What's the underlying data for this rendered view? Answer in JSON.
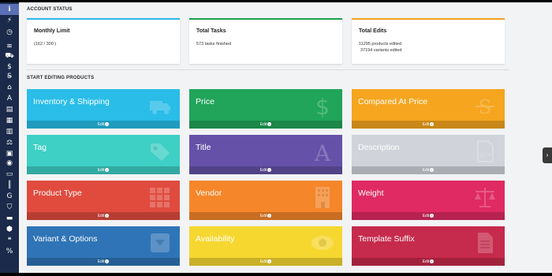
{
  "sidebar": {
    "icons": [
      {
        "name": "info-icon",
        "glyph": "ℹ",
        "active": true
      },
      {
        "name": "bolt-icon",
        "glyph": "⚡"
      },
      {
        "name": "clock-icon",
        "glyph": "◷"
      },
      {
        "name": "layers-icon",
        "glyph": "≋"
      },
      {
        "name": "truck-icon",
        "glyph": "⛟"
      },
      {
        "name": "dollar-icon",
        "glyph": "$"
      },
      {
        "name": "strikethrough-icon",
        "glyph": "S̶"
      },
      {
        "name": "tag-icon",
        "glyph": "⌂"
      },
      {
        "name": "font-icon",
        "glyph": "A"
      },
      {
        "name": "file-icon",
        "glyph": "▤"
      },
      {
        "name": "grid-icon",
        "glyph": "▦"
      },
      {
        "name": "barcode-icon",
        "glyph": "▥"
      },
      {
        "name": "balance-icon",
        "glyph": "⚖"
      },
      {
        "name": "box-icon",
        "glyph": "▣"
      },
      {
        "name": "eye-icon",
        "glyph": "◉"
      },
      {
        "name": "document-icon",
        "glyph": "▭"
      },
      {
        "name": "barcode2-icon",
        "glyph": "║"
      },
      {
        "name": "google-icon",
        "glyph": "G"
      },
      {
        "name": "cart-icon",
        "glyph": "⛉"
      },
      {
        "name": "shipping-icon",
        "glyph": "▬"
      },
      {
        "name": "cubes-icon",
        "glyph": "⬢"
      },
      {
        "name": "quote-icon",
        "glyph": "❝"
      },
      {
        "name": "percent-icon",
        "glyph": "%"
      }
    ]
  },
  "account_status": {
    "title": "ACCOUNT STATUS",
    "cards": [
      {
        "title": "Monthly Limit",
        "lines": [
          "(162 / 300 )"
        ],
        "accent": "#29b6e8"
      },
      {
        "title": "Total Tasks",
        "lines": [
          "573 tasks finished"
        ],
        "accent": "#1e9e50"
      },
      {
        "title": "Total Edits",
        "lines": [
          "11295 products edited",
          "37194 variants edited"
        ],
        "accent": "#f0a11e"
      }
    ]
  },
  "editing": {
    "title": "START EDITING PRODUCTS",
    "edit_label": "Edit",
    "tiles": [
      {
        "label": "Inventory & Shipping",
        "color": "#29bde8",
        "icon": "truck-icon"
      },
      {
        "label": "Price",
        "color": "#21a55a",
        "icon": "dollar-icon"
      },
      {
        "label": "Compared At Price",
        "color": "#f5a51e",
        "icon": "strikethrough-icon"
      },
      {
        "label": "Tag",
        "color": "#3ecfc5",
        "icon": "tag-icon"
      },
      {
        "label": "Title",
        "color": "#6552a8",
        "icon": "font-icon"
      },
      {
        "label": "Description",
        "color": "#d0d4da",
        "icon": "code-file-icon"
      },
      {
        "label": "Product Type",
        "color": "#e04b3e",
        "icon": "grid-icon"
      },
      {
        "label": "Vendor",
        "color": "#f5862a",
        "icon": "building-icon"
      },
      {
        "label": "Weight",
        "color": "#df2a63",
        "icon": "balance-icon"
      },
      {
        "label": "Variant & Options",
        "color": "#2f74b6",
        "icon": "box-icon"
      },
      {
        "label": "Availability",
        "color": "#f6d730",
        "icon": "eye-icon"
      },
      {
        "label": "Template Suffix",
        "color": "#c62a4c",
        "icon": "document-icon"
      }
    ]
  }
}
